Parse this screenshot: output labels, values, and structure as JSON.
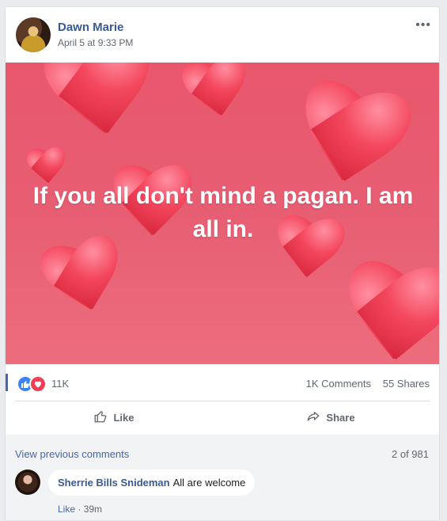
{
  "post": {
    "author": "Dawn Marie",
    "timestamp": "April 5 at 9:33 PM",
    "more_label": "•••",
    "text": "If you all don't mind a pagan. I am all in."
  },
  "stats": {
    "reaction_count": "11K",
    "comments": "1K Comments",
    "shares": "55 Shares"
  },
  "actions": {
    "like": "Like",
    "share": "Share"
  },
  "comments": {
    "view_previous": "View previous comments",
    "page_count": "2 of 981",
    "items": [
      {
        "name": "Sherrie Bills Snideman",
        "text": "All are welcome",
        "like_label": "Like",
        "separator": "·",
        "time": "39m"
      }
    ]
  },
  "colors": {
    "brand": "#4267b2",
    "link": "#385898",
    "hero_bg": "#e9576d"
  },
  "icons": [
    "more-options-icon",
    "like-reaction-icon",
    "love-reaction-icon",
    "thumbs-up-icon",
    "share-arrow-icon"
  ]
}
